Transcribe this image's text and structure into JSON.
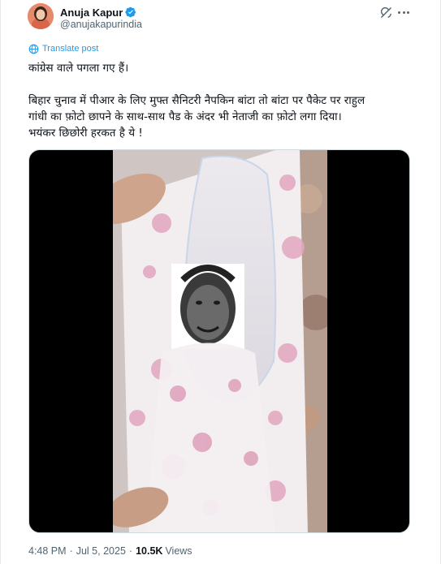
{
  "author": {
    "name": "Anuja Kapur",
    "handle": "@anujakapurindia",
    "avatar_icon": "profile-photo",
    "verified_color": "#1d9bf0"
  },
  "header_actions": {
    "grok_icon": "grok-icon",
    "more_icon": "more-horizontal-icon"
  },
  "translate": {
    "label": "Translate post",
    "icon": "translate-globe-icon"
  },
  "tweet": {
    "lines": [
      "कांग्रेस वाले पगला गए हैं।",
      "बिहार चुनाव में पीआर के लिए मुफ्त सैनिटरी नैपकिन बांटा तो बांटा पर पैकेट पर राहुल",
      "गांधी का फ़ोटो छापने के साथ-साथ पैड के अंदर भी  नेताजी का फ़ोटो लगा दिया।",
      "भयंकर छिछोरी हरकत है ये !"
    ]
  },
  "media": {
    "type": "video"
  },
  "meta": {
    "time": "4:48 PM",
    "separator": "·",
    "date": "Jul 5, 2025",
    "views_count": "10.5K",
    "views_label": "Views"
  },
  "colors": {
    "text": "#0f1419",
    "secondary": "#536471",
    "link": "#1d9bf0",
    "border": "#e6e9ec"
  }
}
